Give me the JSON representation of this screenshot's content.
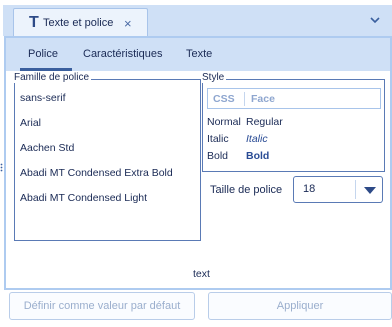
{
  "header": {
    "doc_tab_icon": "T",
    "doc_tab_label": "Texte et police",
    "close_glyph": "×",
    "menu_icon": "chevron-down-icon"
  },
  "subtabs": {
    "items": [
      "Police",
      "Caractéristiques",
      "Texte"
    ],
    "active": "Police"
  },
  "family": {
    "legend": "Famille de police",
    "items": [
      "sans-serif",
      "Arial",
      "Aachen Std",
      "Abadi MT Condensed Extra Bold",
      "Abadi MT Condensed Light"
    ]
  },
  "style": {
    "legend": "Style",
    "col_css": "CSS",
    "col_face": "Face",
    "rows": [
      {
        "css": "Normal",
        "face": "Regular"
      },
      {
        "css": "Italic",
        "face": "Italic"
      },
      {
        "css": "Bold",
        "face": "Bold"
      }
    ]
  },
  "size": {
    "label": "Taille de police",
    "value": "18"
  },
  "preview": {
    "text": "text"
  },
  "buttons": {
    "default": "Définir comme valeur par défaut",
    "apply": "Appliquer"
  },
  "colors": {
    "accent": "#3a5f9e",
    "header_bg": "#cfe0f6",
    "border": "#5a7ab5"
  }
}
